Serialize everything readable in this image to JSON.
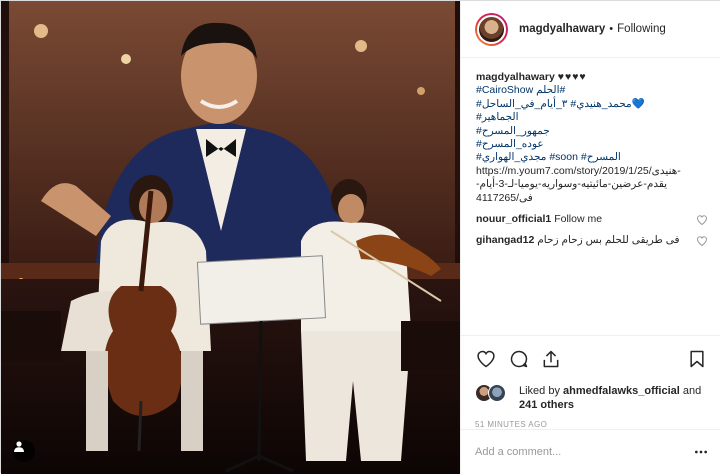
{
  "post": {
    "username": "magdyalhawary",
    "follow_separator": "•",
    "follow_status": "Following",
    "caption": {
      "username": "magdyalhawary",
      "hearts": "♥♥♥♥",
      "lines": [
        {
          "text": "#CairoShow الحلم#",
          "kind": "tag"
        },
        {
          "text": "💙محمد_هنيدي# ٣_أيام_في_الساحل#",
          "kind": "tag"
        },
        {
          "text": "الجماهير#",
          "kind": "tag"
        },
        {
          "text": "جمهور_المسرح#",
          "kind": "tag"
        },
        {
          "text": "عوده_المسرح#",
          "kind": "tag"
        },
        {
          "text": "المسرح# soon# مجدي_الهواري#",
          "kind": "tag"
        },
        {
          "text": "https://m.youm7.com/story/2019/1/25/هنيدى-",
          "kind": "plain"
        },
        {
          "text": "يقدم-عرضين-مائيتيه-وسواريه-يوميا-لـ-3-أيام-فى/4117265",
          "kind": "plain"
        }
      ]
    },
    "comments": [
      {
        "username": "nouur_official1",
        "text": "Follow me"
      },
      {
        "username": "gihangad12",
        "text": "فى طريقى للحلم بس زحام زحام"
      }
    ],
    "likes": {
      "prefix": "Liked by",
      "liker": "ahmedfalawks_official",
      "joiner": "and",
      "others": "241 others"
    },
    "timestamp": "51 minutes ago",
    "add_comment_placeholder": "Add a comment..."
  },
  "icons": {
    "like": "heart-icon",
    "comment": "comment-icon",
    "share": "share-icon",
    "save": "bookmark-icon",
    "more": "more-options-icon",
    "user_tag": "user-tag-icon"
  },
  "colors": {
    "link": "#003569",
    "muted": "#999999",
    "border": "#efefef"
  }
}
